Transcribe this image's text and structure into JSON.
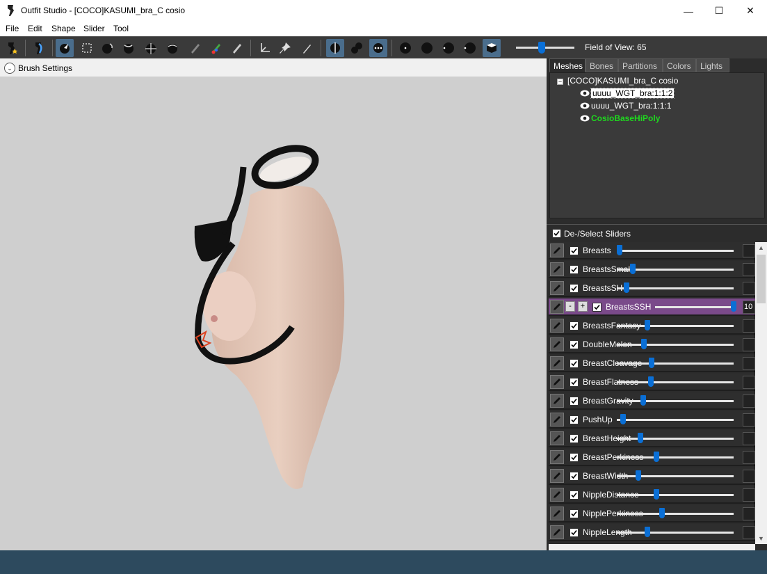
{
  "window": {
    "title": "Outfit Studio - [COCO]KASUMI_bra_C cosio",
    "minimize_glyph": "—",
    "maximize_glyph": "☐",
    "close_glyph": "✕"
  },
  "menu": {
    "items": [
      "File",
      "Edit",
      "Shape",
      "Slider",
      "Tool"
    ]
  },
  "toolbar": {
    "field_of_view_label": "Field of View: 65",
    "field_of_view_value": 65,
    "tools": [
      "slider-brush-icon",
      "pose-icon",
      "select-icon",
      "select-rect-icon",
      "inflate-icon",
      "deflate-icon",
      "move-icon",
      "smooth-icon",
      "mask-icon",
      "color-icon",
      "alpha-icon",
      "transform-icon",
      "pivot-icon",
      "pen-icon",
      "x-mirror-icon",
      "connected-icon",
      "global-icon",
      "brush-dot-1-icon",
      "brush-dot-2-icon",
      "brush-dot-3-icon",
      "brush-dot-4-icon",
      "cube-icon"
    ]
  },
  "viewport": {
    "brush_settings_label": "Brush Settings",
    "background_color": "#cfcfcf"
  },
  "right_panel": {
    "tabs": [
      "Meshes",
      "Bones",
      "Partitions",
      "Colors",
      "Lights"
    ],
    "active_tab": "Meshes",
    "tree": {
      "root": "[COCO]KASUMI_bra_C cosio",
      "expander": "−",
      "children": [
        {
          "label": "uuuu_WGT_bra:1:1:2",
          "selected": true,
          "color": "#ffffff"
        },
        {
          "label": "uuuu_WGT_bra:1:1:1",
          "selected": false,
          "color": "#ffffff"
        },
        {
          "label": "CosioBaseHiPoly",
          "selected": false,
          "color": "#1fd81f"
        }
      ]
    },
    "slider_header": "De-/Select Sliders",
    "sliders": [
      {
        "name": "Breasts",
        "level": 0.0,
        "selected": false,
        "value": ""
      },
      {
        "name": "BreastsSmall",
        "level": 0.12,
        "selected": false,
        "value": ""
      },
      {
        "name": "BreastsSH",
        "level": 0.06,
        "selected": false,
        "value": ""
      },
      {
        "name": "BreastsSSH",
        "level": 1.0,
        "selected": true,
        "value": "10"
      },
      {
        "name": "BreastsFantasy",
        "level": 0.25,
        "selected": false,
        "value": ""
      },
      {
        "name": "DoubleMelon",
        "level": 0.22,
        "selected": false,
        "value": ""
      },
      {
        "name": "BreastCleavage",
        "level": 0.29,
        "selected": false,
        "value": ""
      },
      {
        "name": "BreastFlatness",
        "level": 0.28,
        "selected": false,
        "value": ""
      },
      {
        "name": "BreastGravity",
        "level": 0.21,
        "selected": false,
        "value": ""
      },
      {
        "name": "PushUp",
        "level": 0.03,
        "selected": false,
        "value": ""
      },
      {
        "name": "BreastHeight",
        "level": 0.19,
        "selected": false,
        "value": ""
      },
      {
        "name": "BreastPerkiness",
        "level": 0.33,
        "selected": false,
        "value": ""
      },
      {
        "name": "BreastWidth",
        "level": 0.17,
        "selected": false,
        "value": ""
      },
      {
        "name": "NippleDistance",
        "level": 0.33,
        "selected": false,
        "value": ""
      },
      {
        "name": "NipplePerkiness",
        "level": 0.38,
        "selected": false,
        "value": ""
      },
      {
        "name": "NippleLength",
        "level": 0.25,
        "selected": false,
        "value": ""
      }
    ],
    "minus_label": "-",
    "plus_label": "+"
  },
  "colors": {
    "accent": "#0a6fd6",
    "selected_row": "#7a4a8a",
    "panel": "#2c2c2c",
    "highlight_mesh": "#1fd81f"
  }
}
